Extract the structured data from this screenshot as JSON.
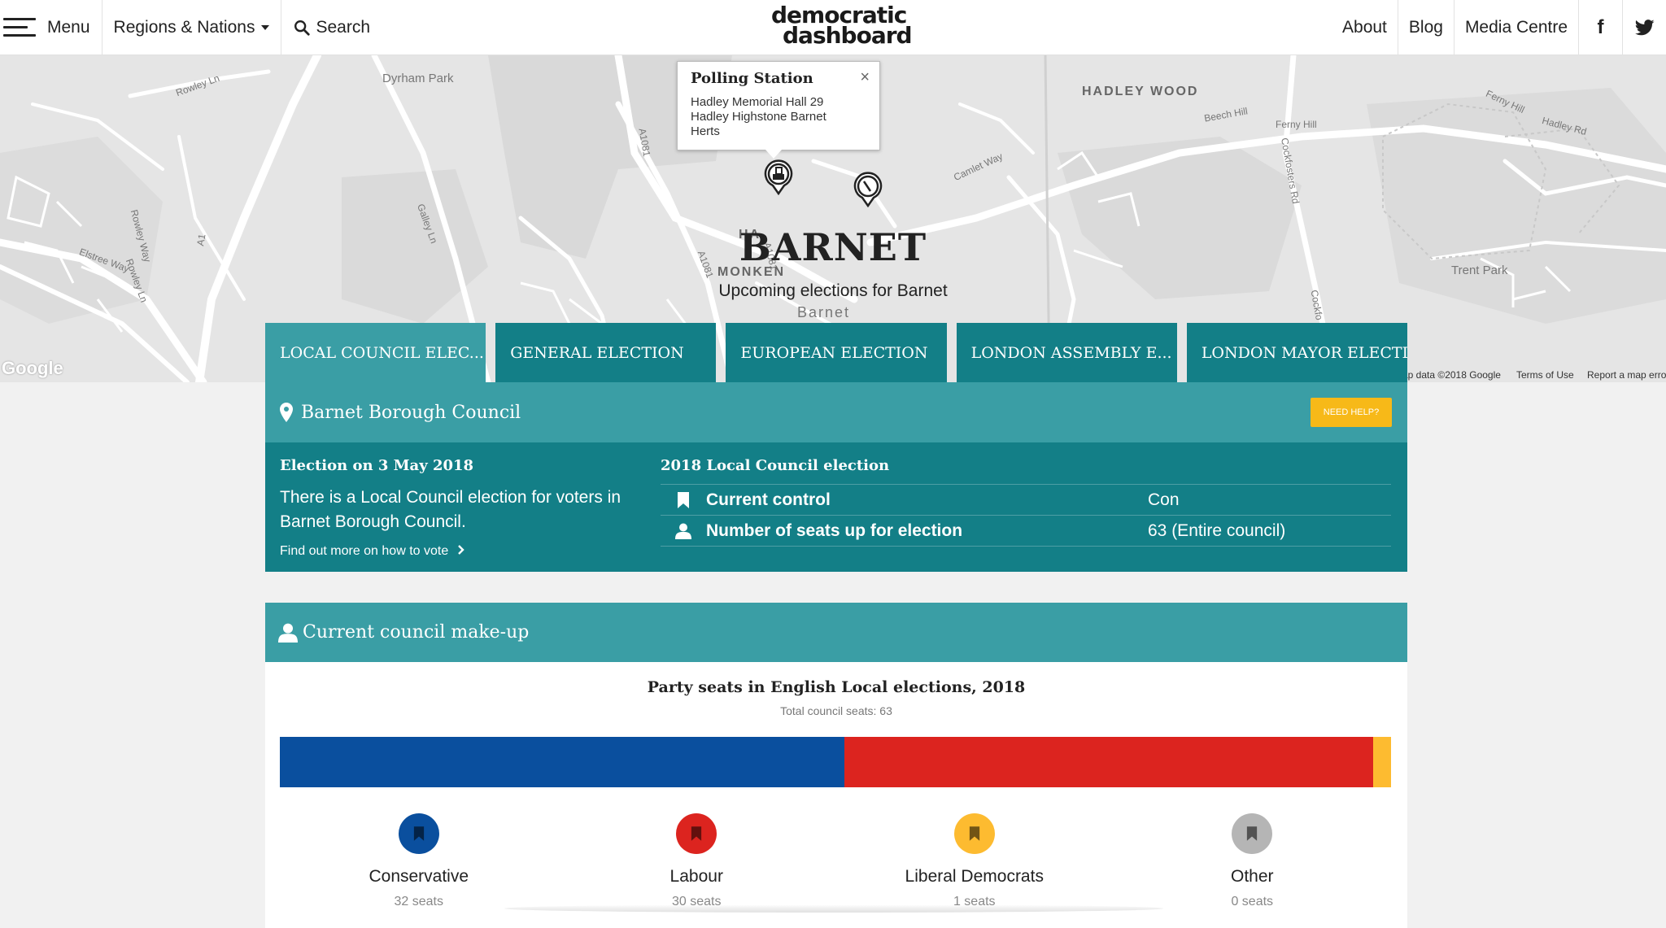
{
  "nav": {
    "menu_label": "Menu",
    "regions_label": "Regions & Nations",
    "search_label": "Search",
    "logo_line1": "democratic",
    "logo_line2": "dashboard",
    "about_label": "About",
    "blog_label": "Blog",
    "media_label": "Media Centre",
    "facebook_glyph": "f"
  },
  "map": {
    "labels": {
      "dyrham_park": "Dyrham Park",
      "rowley_ln": "Rowley Ln",
      "rowley_ln2": "Rowley Ln",
      "rowley_way": "Rowley Way",
      "elstree_way": "Elstree Way",
      "a1": "A1",
      "gallev_ln": "Galley Ln",
      "a1081_top": "A1081",
      "a1081_mid": "A1081",
      "a1081_low": "A1081",
      "hadley_wood": "HADLEY WOOD",
      "beech_hill": "Beech Hill",
      "ferny_hill": "Ferny Hill",
      "ferny_hill2": "Ferny Hill",
      "hadley_rd": "Hadley Rd",
      "camlet_way": "Camlet Way",
      "cockfosters_rd": "Cockfosters Rd",
      "cockfosters_rd2": "Cockfo",
      "trent_park": "Trent Park",
      "monken": "MONKEN",
      "barnet": "Barnet",
      "hadley_partial": "HA"
    },
    "google_logo": "Google",
    "attribution": {
      "map_data": "ap data ©2018 Google",
      "terms": "Terms of Use",
      "report": "Report a map erro"
    }
  },
  "popup": {
    "title": "Polling Station",
    "address": "Hadley Memorial Hall 29 Hadley Highstone Barnet Herts",
    "close": "×"
  },
  "hero": {
    "title": "BARNET",
    "subtitle": "Upcoming elections for Barnet"
  },
  "tabs": [
    {
      "label": "LOCAL COUNCIL ELEC...",
      "active": true
    },
    {
      "label": "GENERAL ELECTION",
      "active": false
    },
    {
      "label": "EUROPEAN ELECTION",
      "active": false
    },
    {
      "label": "LONDON ASSEMBLY E...",
      "active": false
    },
    {
      "label": "LONDON MAYOR ELECTI...",
      "active": false
    }
  ],
  "council": {
    "name": "Barnet Borough Council",
    "help_label": "NEED HELP?",
    "election_date": "Election on 3 May 2018",
    "description": "There is a Local Council election for voters in Barnet Borough Council.",
    "link_label": "Find out more on how to vote",
    "details_title": "2018 Local Council election",
    "rows": [
      {
        "label": "Current control",
        "value": "Con",
        "icon": "bookmark-icon"
      },
      {
        "label": "Number of seats up for election",
        "value": "63 (Entire council)",
        "icon": "person-icon"
      }
    ]
  },
  "makeup": {
    "heading": "Current council make-up",
    "chart_title": "Party seats in English Local elections, 2018",
    "total_label": "Total council seats: 63"
  },
  "chart_data": {
    "type": "bar",
    "title": "Party seats in English Local elections, 2018",
    "subtitle": "Total council seats: 63",
    "categories": [
      "Conservative",
      "Labour",
      "Liberal Democrats",
      "Other"
    ],
    "values": [
      32,
      30,
      1,
      0
    ],
    "colors": [
      "#0a4f9e",
      "#dc241f",
      "#fdbb30",
      "#b5b5b5"
    ],
    "seat_labels": [
      "32 seats",
      "30 seats",
      "1 seats",
      "0 seats"
    ]
  },
  "colors": {
    "teal_dark": "#137f87",
    "teal_light": "#3a9ea5",
    "help_yellow": "#f7b918"
  }
}
